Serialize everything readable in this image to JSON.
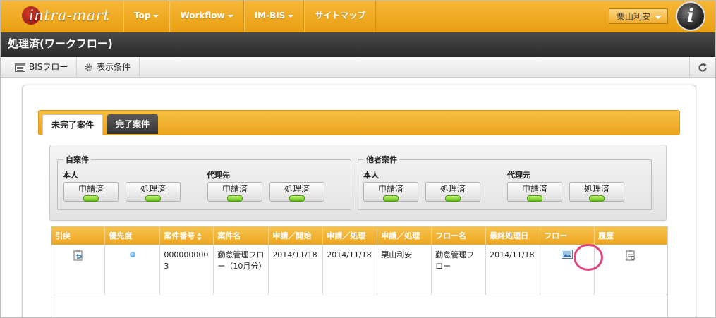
{
  "app": {
    "logo_text": "intra-mart",
    "nav": [
      {
        "label": "Top",
        "has_caret": true
      },
      {
        "label": "Workflow",
        "has_caret": true
      },
      {
        "label": "IM-BIS",
        "has_caret": true
      },
      {
        "label": "サイトマップ",
        "has_caret": false
      }
    ],
    "user_name": "栗山利安",
    "avatar_letter": "i"
  },
  "page": {
    "title": "処理済(ワークフロー)"
  },
  "toolbar": {
    "bis_flow_label": "BISフロー",
    "display_condition_label": "表示条件",
    "bis_flow_icon": "list-window-icon",
    "display_condition_icon": "gear-icon",
    "refresh_icon": "refresh-icon"
  },
  "tabs": [
    {
      "label": "未完了案件",
      "active": true
    },
    {
      "label": "完了案件",
      "active": false
    }
  ],
  "filters": {
    "own": {
      "legend": "自案件",
      "groups": [
        {
          "label": "本人",
          "buttons": [
            "申請済",
            "処理済"
          ]
        },
        {
          "label": "代理先",
          "buttons": [
            "申請済",
            "処理済"
          ]
        }
      ]
    },
    "others": {
      "legend": "他者案件",
      "groups": [
        {
          "label": "本人",
          "buttons": [
            "申請済",
            "処理済"
          ]
        },
        {
          "label": "代理元",
          "buttons": [
            "申請済",
            "処理済"
          ]
        }
      ]
    }
  },
  "table": {
    "columns": [
      "引戻",
      "優先度",
      "案件番号",
      "案件名",
      "申請／開始",
      "申請／処理",
      "申請／処理",
      "フロー名",
      "最終処理日",
      "フロー",
      "履歴"
    ],
    "rows": [
      {
        "case_number": "0000000003",
        "case_name": "勤怠管理フロー（10月分）",
        "applied_date": "2014/11/18",
        "processed_date": "2014/11/18",
        "processor": "栗山利安",
        "flow_name": "勤怠管理フロー",
        "last_processed": "2014/11/18"
      }
    ]
  },
  "colors": {
    "accent": "#eea51f",
    "header_dark": "#333333",
    "led_green": "#5dbf12",
    "highlight": "#e0447f"
  }
}
